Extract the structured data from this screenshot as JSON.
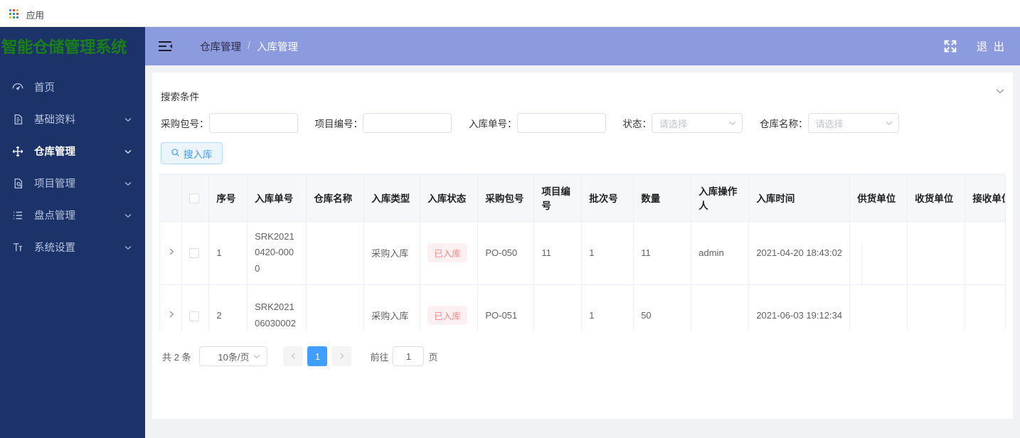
{
  "browser": {
    "bookmark_label": "应用"
  },
  "sidebar": {
    "logo": "智能仓储管理系统",
    "items": [
      {
        "label": "首页",
        "icon": "dashboard-icon",
        "expandable": false,
        "active": false
      },
      {
        "label": "基础资料",
        "icon": "document-icon",
        "expandable": true,
        "active": false
      },
      {
        "label": "仓库管理",
        "icon": "move-icon",
        "expandable": true,
        "active": true
      },
      {
        "label": "项目管理",
        "icon": "document-search-icon",
        "expandable": true,
        "active": false
      },
      {
        "label": "盘点管理",
        "icon": "list-icon",
        "expandable": true,
        "active": false
      },
      {
        "label": "系统设置",
        "icon": "text-format-icon",
        "expandable": true,
        "active": false
      }
    ]
  },
  "header": {
    "fold_icon": "menu-fold-icon",
    "breadcrumb_parent": "仓库管理",
    "breadcrumb_separator": "/",
    "breadcrumb_current": "入库管理",
    "fullscreen_icon": "fullscreen-icon",
    "logout_label": "退 出"
  },
  "search": {
    "title": "搜索条件",
    "collapse_icon": "chevron-down-icon",
    "fields": [
      {
        "label": "采购包号：",
        "value": "",
        "placeholder": ""
      },
      {
        "label": "项目编号：",
        "value": "",
        "placeholder": ""
      },
      {
        "label": "入库单号：",
        "value": "",
        "placeholder": ""
      }
    ],
    "selects": [
      {
        "label": "状态：",
        "value": "请选择"
      },
      {
        "label": "仓库名称：",
        "value": "请选择"
      }
    ],
    "button": {
      "label": "搜入库",
      "icon": "search-icon"
    }
  },
  "table": {
    "columns": [
      "序号",
      "入库单号",
      "仓库名称",
      "入库类型",
      "入库状态",
      "采购包号",
      "项目编号",
      "批次号",
      "数量",
      "入库操作人",
      "入库时间",
      "供货单位",
      "收货单位",
      "接收单位"
    ],
    "rows": [
      {
        "expand_icon": "chevron-right-icon",
        "checked": false,
        "index": "1",
        "order_no": "SRK20210420-0000",
        "warehouse": "",
        "type": "采购入库",
        "state": "已入库",
        "package_no": "PO-050",
        "project_no": "11",
        "batch_no": "1",
        "quantity": "11",
        "operator": "admin",
        "time": "2021-04-20 18:43:02",
        "supplier": "",
        "receiver": "",
        "acceptor": ""
      },
      {
        "expand_icon": "chevron-right-icon",
        "checked": false,
        "index": "2",
        "order_no": "SRK202106030002",
        "warehouse": "",
        "type": "采购入库",
        "state": "已入库",
        "package_no": "PO-051",
        "project_no": "",
        "batch_no": "1",
        "quantity": "50",
        "operator": "",
        "time": "2021-06-03 19:12:34",
        "supplier": "",
        "receiver": "",
        "acceptor": ""
      }
    ]
  },
  "pagination": {
    "total_label": "共 2 条",
    "page_size": "10条/页",
    "prev_icon": "chevron-left-icon",
    "next_icon": "chevron-right-icon",
    "current_page": "1",
    "jump_prefix": "前往",
    "jump_value": "1",
    "jump_suffix": "页"
  },
  "colors": {
    "sidebar_bg": "#1b3368",
    "logo_green": "#1a7f1a",
    "header_purple": "#8c9ade",
    "accent_blue": "#409eff",
    "tag_bg": "#fef0f0",
    "tag_text": "#f78989"
  }
}
